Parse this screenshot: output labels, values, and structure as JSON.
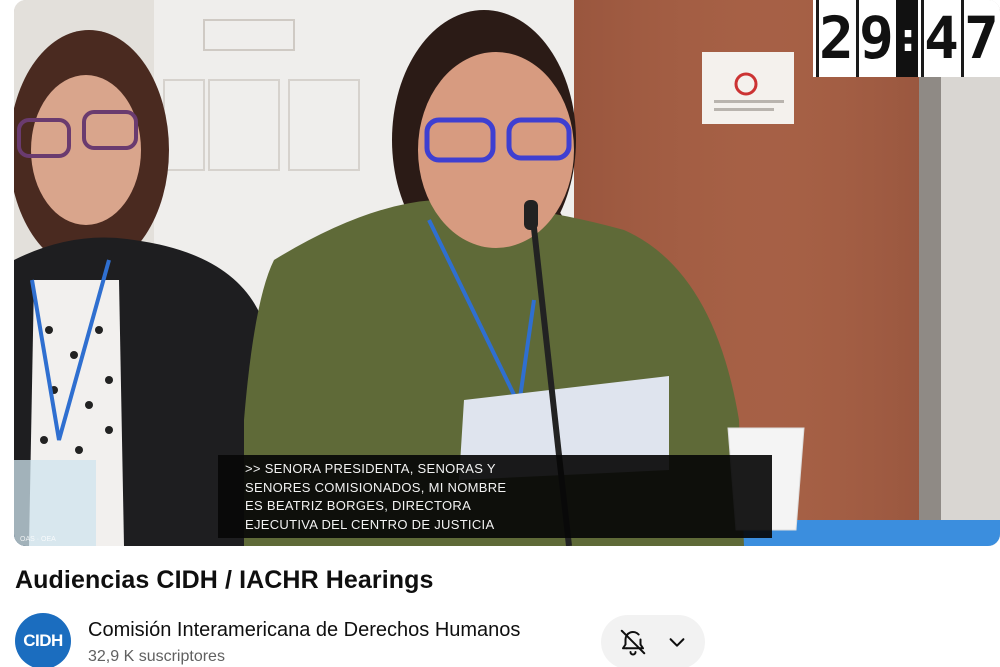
{
  "video": {
    "timer": {
      "digits": [
        "2",
        "9",
        "4",
        "7"
      ],
      "separator": ":"
    },
    "captions": [
      ">> SENORA PRESIDENTA, SENORAS Y",
      "SENORES COMISIONADOS, MI NOMBRE",
      "ES BEATRIZ BORGES, DIRECTORA",
      "EJECUTIVA DEL CENTRO DE JUSTICIA"
    ],
    "watermark": "OAS · OEA"
  },
  "title": "Audiencias CIDH / IACHR Hearings",
  "channel": {
    "avatar_text": "CIDH",
    "name": "Comisión Interamericana de Derechos Humanos",
    "subscribers": "32,9 K suscriptores",
    "avatar_color": "#1b6dbf"
  },
  "actions": {
    "notify_icon": "bell-off-icon",
    "dropdown_icon": "chevron-down-icon"
  }
}
